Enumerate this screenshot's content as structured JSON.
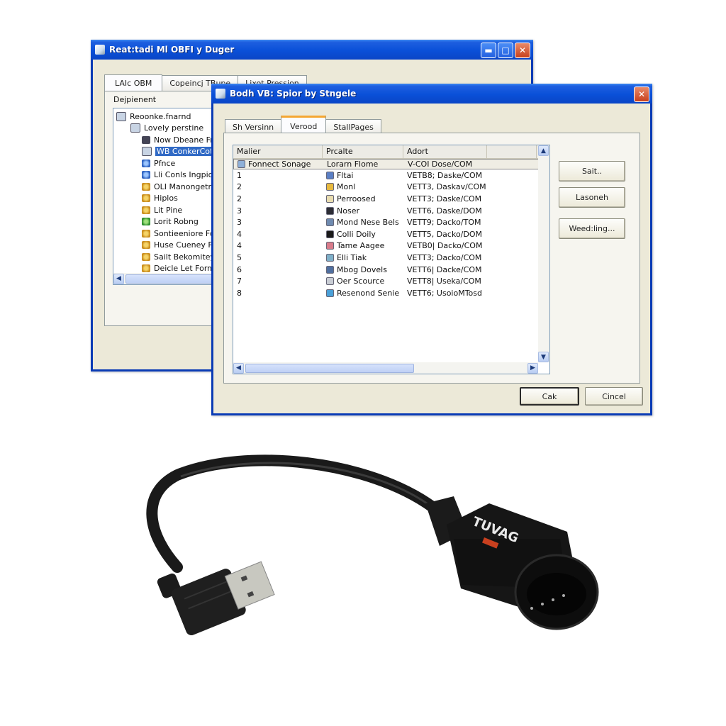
{
  "background_window": {
    "title": "Reat:tadi Ml OBFI y Duger",
    "title_buttons": [
      "minimize",
      "maximize",
      "close"
    ],
    "tabs": [
      "LAIc OBM",
      "Copeincj TBupe",
      "Lixot Pression"
    ],
    "active_tab": 0,
    "section_label": "Dejpienent",
    "tree": {
      "root": "Reoonke.fnarnd",
      "child": "Lovely perstine",
      "items": [
        {
          "label": "Now Dbeane Fror",
          "icon": "device-icon",
          "selected": false
        },
        {
          "label": "WB ConkerCott",
          "icon": "device-icon",
          "selected": true
        },
        {
          "label": "Pfnce",
          "icon": "gear-icon",
          "selected": false
        },
        {
          "label": "Lli Conls Ingpioc",
          "icon": "gear-icon",
          "selected": false
        },
        {
          "label": "OLI Manongetro",
          "icon": "gear-icon",
          "selected": false
        },
        {
          "label": "Hiplos",
          "icon": "gear-icon",
          "selected": false
        },
        {
          "label": "Lit Pine",
          "icon": "gear-icon",
          "selected": false
        },
        {
          "label": "Lorit Robng",
          "icon": "green-gear-icon",
          "selected": false
        },
        {
          "label": "Sontieeniore Fongr",
          "icon": "gear-icon",
          "selected": false
        },
        {
          "label": "Huse Cueney Pro",
          "icon": "gear-icon",
          "selected": false
        },
        {
          "label": "Sailt Bekomitey Pr",
          "icon": "gear-icon",
          "selected": false
        },
        {
          "label": "Deicle Let Forma",
          "icon": "gear-icon",
          "selected": false
        }
      ]
    }
  },
  "dialog": {
    "title": "Bodh VB: Spior by Stngele",
    "tabs": [
      "Sh Versinn",
      "Verood",
      "StallPages"
    ],
    "active_tab": 1,
    "columns": [
      "Malier",
      "Prcalte",
      "Adort",
      ""
    ],
    "group_row": {
      "c1": "Fonnect Sonage",
      "c2": "Lorarn Flome",
      "c3": "V-COI  Dose/COM"
    },
    "rows": [
      {
        "num": "1",
        "name": "Fltai",
        "icon": "globe-icon",
        "code": "VETB8;  Daske/COM"
      },
      {
        "num": "2",
        "name": "Monl",
        "icon": "gear-icon",
        "code": "VETT3,  Daskav/COM"
      },
      {
        "num": "2",
        "name": "Perroosed",
        "icon": "folder-icon",
        "code": "VETT3;  Daske/COM"
      },
      {
        "num": "3",
        "name": "Noser",
        "icon": "monitor-icon",
        "code": "VETT6,  Daske/DOM"
      },
      {
        "num": "3",
        "name": "Mond Nese Bels",
        "icon": "disk-icon",
        "code": "VETT9;  Dacko/TOM"
      },
      {
        "num": "4",
        "name": "Colli Doily",
        "icon": "terminal-icon",
        "code": "VETT5,  Dacko/DOM"
      },
      {
        "num": "4",
        "name": "Tame Aagee",
        "icon": "image-icon",
        "code": "VETB0|  Dacko/COM"
      },
      {
        "num": "5",
        "name": "Elli Tiak",
        "icon": "refresh-icon",
        "code": "VETT3;  Dacko/COM"
      },
      {
        "num": "6",
        "name": "Mbog Dovels",
        "icon": "chart-icon",
        "code": "VETT6|  Dacke/COM"
      },
      {
        "num": "7",
        "name": "Oer Scource",
        "icon": "document-icon",
        "code": "VETT8|  Useka/COM"
      },
      {
        "num": "8",
        "name": "Resenond Senie",
        "icon": "drive-icon",
        "code": "VETT6;  UsoioMTosd"
      }
    ],
    "side_buttons": [
      "Sait..",
      "Lasoneh",
      "Weed:ling..."
    ],
    "ok_label": "Cak",
    "cancel_label": "Cincel"
  },
  "device": {
    "name": "OBD2 to USB cable",
    "brand_label": "TUVAG",
    "colors": {
      "body": "#141414",
      "badge": "#c9401f",
      "usb_metal": "#c8c8c0"
    }
  }
}
